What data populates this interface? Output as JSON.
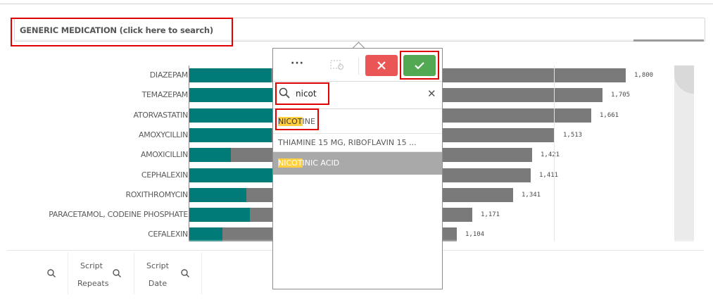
{
  "filter": {
    "label": "GENERIC MEDICATION (click here to search)"
  },
  "chart_data": {
    "type": "bar",
    "categories": [
      "DIAZEPAM",
      "TEMAZEPAM",
      "ATORVASTATIN",
      "AMOXYCILLIN",
      "AMOXICILLIN",
      "CEPHALEXIN",
      "ROXITHROMYCIN",
      "PARACETAMOL, CODEINE PHOSPHATE",
      "CEFALEXIN"
    ],
    "value_labels": [
      "1,800",
      "1,705",
      "1,661",
      "1,513",
      "1,421",
      "1,411",
      "1,341",
      "1,171",
      "1,104"
    ]
  },
  "popup": {
    "more_label": "···",
    "search": {
      "value": "nicot",
      "placeholder": ""
    },
    "items": [
      {
        "match": "NICOT",
        "rest": "INE",
        "state": "possible"
      },
      {
        "match": "",
        "rest": "THIAMINE 15 MG, RIBOFLAVIN 15 ...",
        "state": "possible"
      },
      {
        "match": "NICOT",
        "rest": "INIC ACID",
        "state": "alternative"
      }
    ],
    "colors": {
      "cancel": "#ea5656",
      "confirm": "#53a953",
      "alternative": "#a9a9a9",
      "highlight": "#ffcf3f"
    }
  },
  "table_header": {
    "col_script_repeats_line1": "Script",
    "col_script_repeats_line2": "Repeats",
    "col_script_date_line1": "Script",
    "col_script_date_line2": "Date"
  }
}
